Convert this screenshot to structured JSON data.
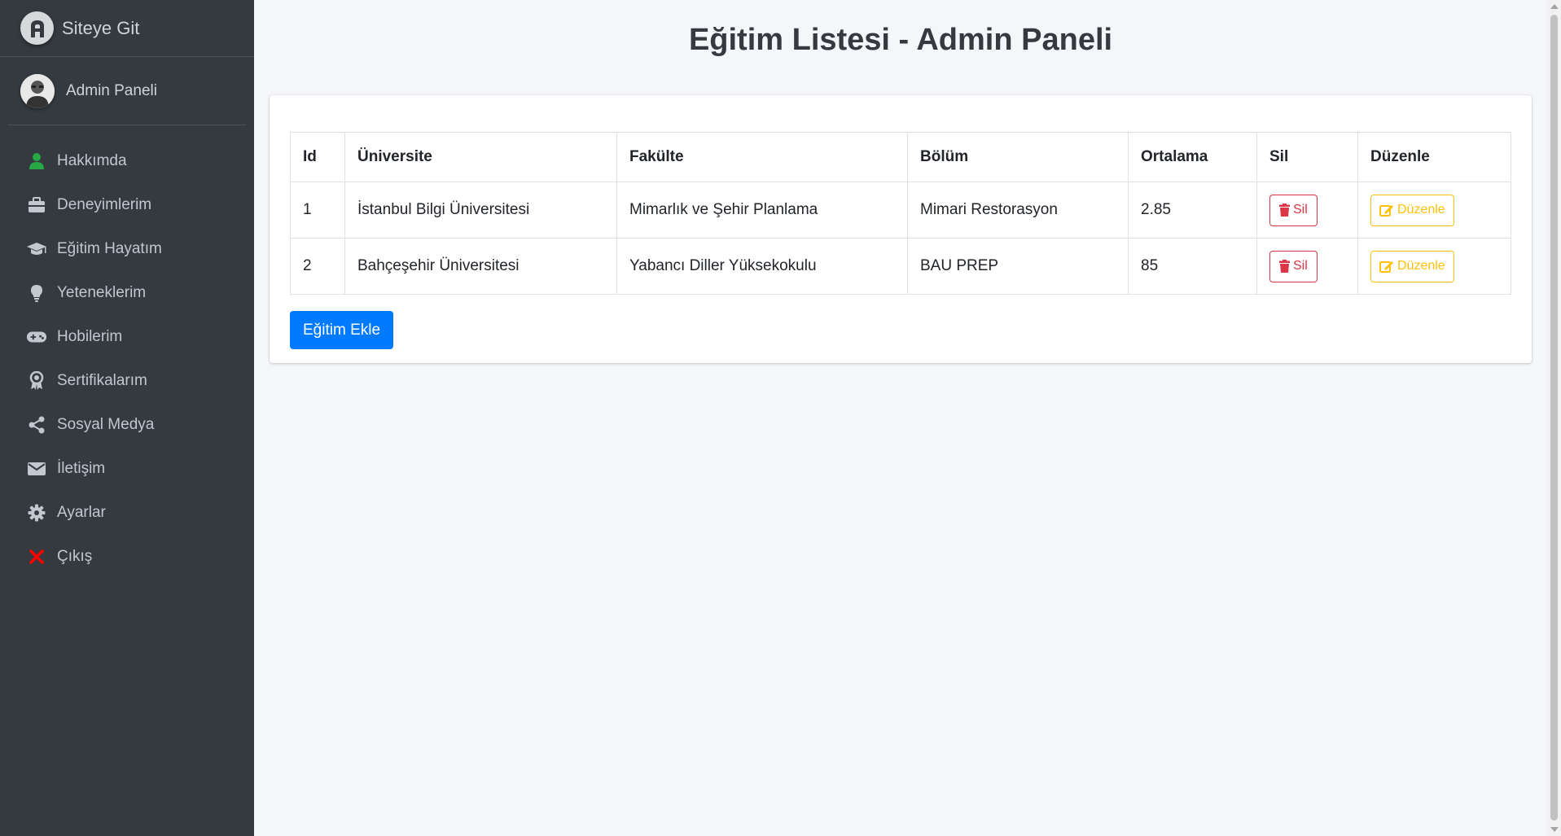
{
  "brand": {
    "text": "Siteye Git"
  },
  "user": {
    "name": "Admin Paneli"
  },
  "nav": [
    {
      "label": "Hakkımda",
      "icon": "user-icon"
    },
    {
      "label": "Deneyimlerim",
      "icon": "briefcase-icon"
    },
    {
      "label": "Eğitim Hayatım",
      "icon": "graduation-cap-icon"
    },
    {
      "label": "Yeteneklerim",
      "icon": "lightbulb-icon"
    },
    {
      "label": "Hobilerim",
      "icon": "gamepad-icon"
    },
    {
      "label": "Sertifikalarım",
      "icon": "award-icon"
    },
    {
      "label": "Sosyal Medya",
      "icon": "share-icon"
    },
    {
      "label": "İletişim",
      "icon": "envelope-icon"
    },
    {
      "label": "Ayarlar",
      "icon": "gear-icon"
    },
    {
      "label": "Çıkış",
      "icon": "close-icon"
    }
  ],
  "page": {
    "title": "Eğitim Listesi - Admin Paneli"
  },
  "table": {
    "headers": [
      "Id",
      "Üniversite",
      "Fakülte",
      "Bölüm",
      "Ortalama",
      "Sil",
      "Düzenle"
    ],
    "rows": [
      {
        "id": "1",
        "universite": "İstanbul Bilgi Üniversitesi",
        "fakulte": "Mimarlık ve Şehir Planlama",
        "bolum": "Mimari Restorasyon",
        "ortalama": "2.85",
        "sil": "Sil",
        "duzenle": "Düzenle"
      },
      {
        "id": "2",
        "universite": "Bahçeşehir Üniversitesi",
        "fakulte": "Yabancı Diller Yüksekokulu",
        "bolum": "BAU PREP",
        "ortalama": "85",
        "sil": "Sil",
        "duzenle": "Düzenle"
      }
    ]
  },
  "actions": {
    "add_label": "Eğitim Ekle"
  },
  "colors": {
    "sidebar_bg": "#343a40",
    "primary": "#007bff",
    "danger": "#dc3545",
    "warning": "#ffc107",
    "success_icon": "#28a745",
    "close_icon": "#ff0000"
  }
}
